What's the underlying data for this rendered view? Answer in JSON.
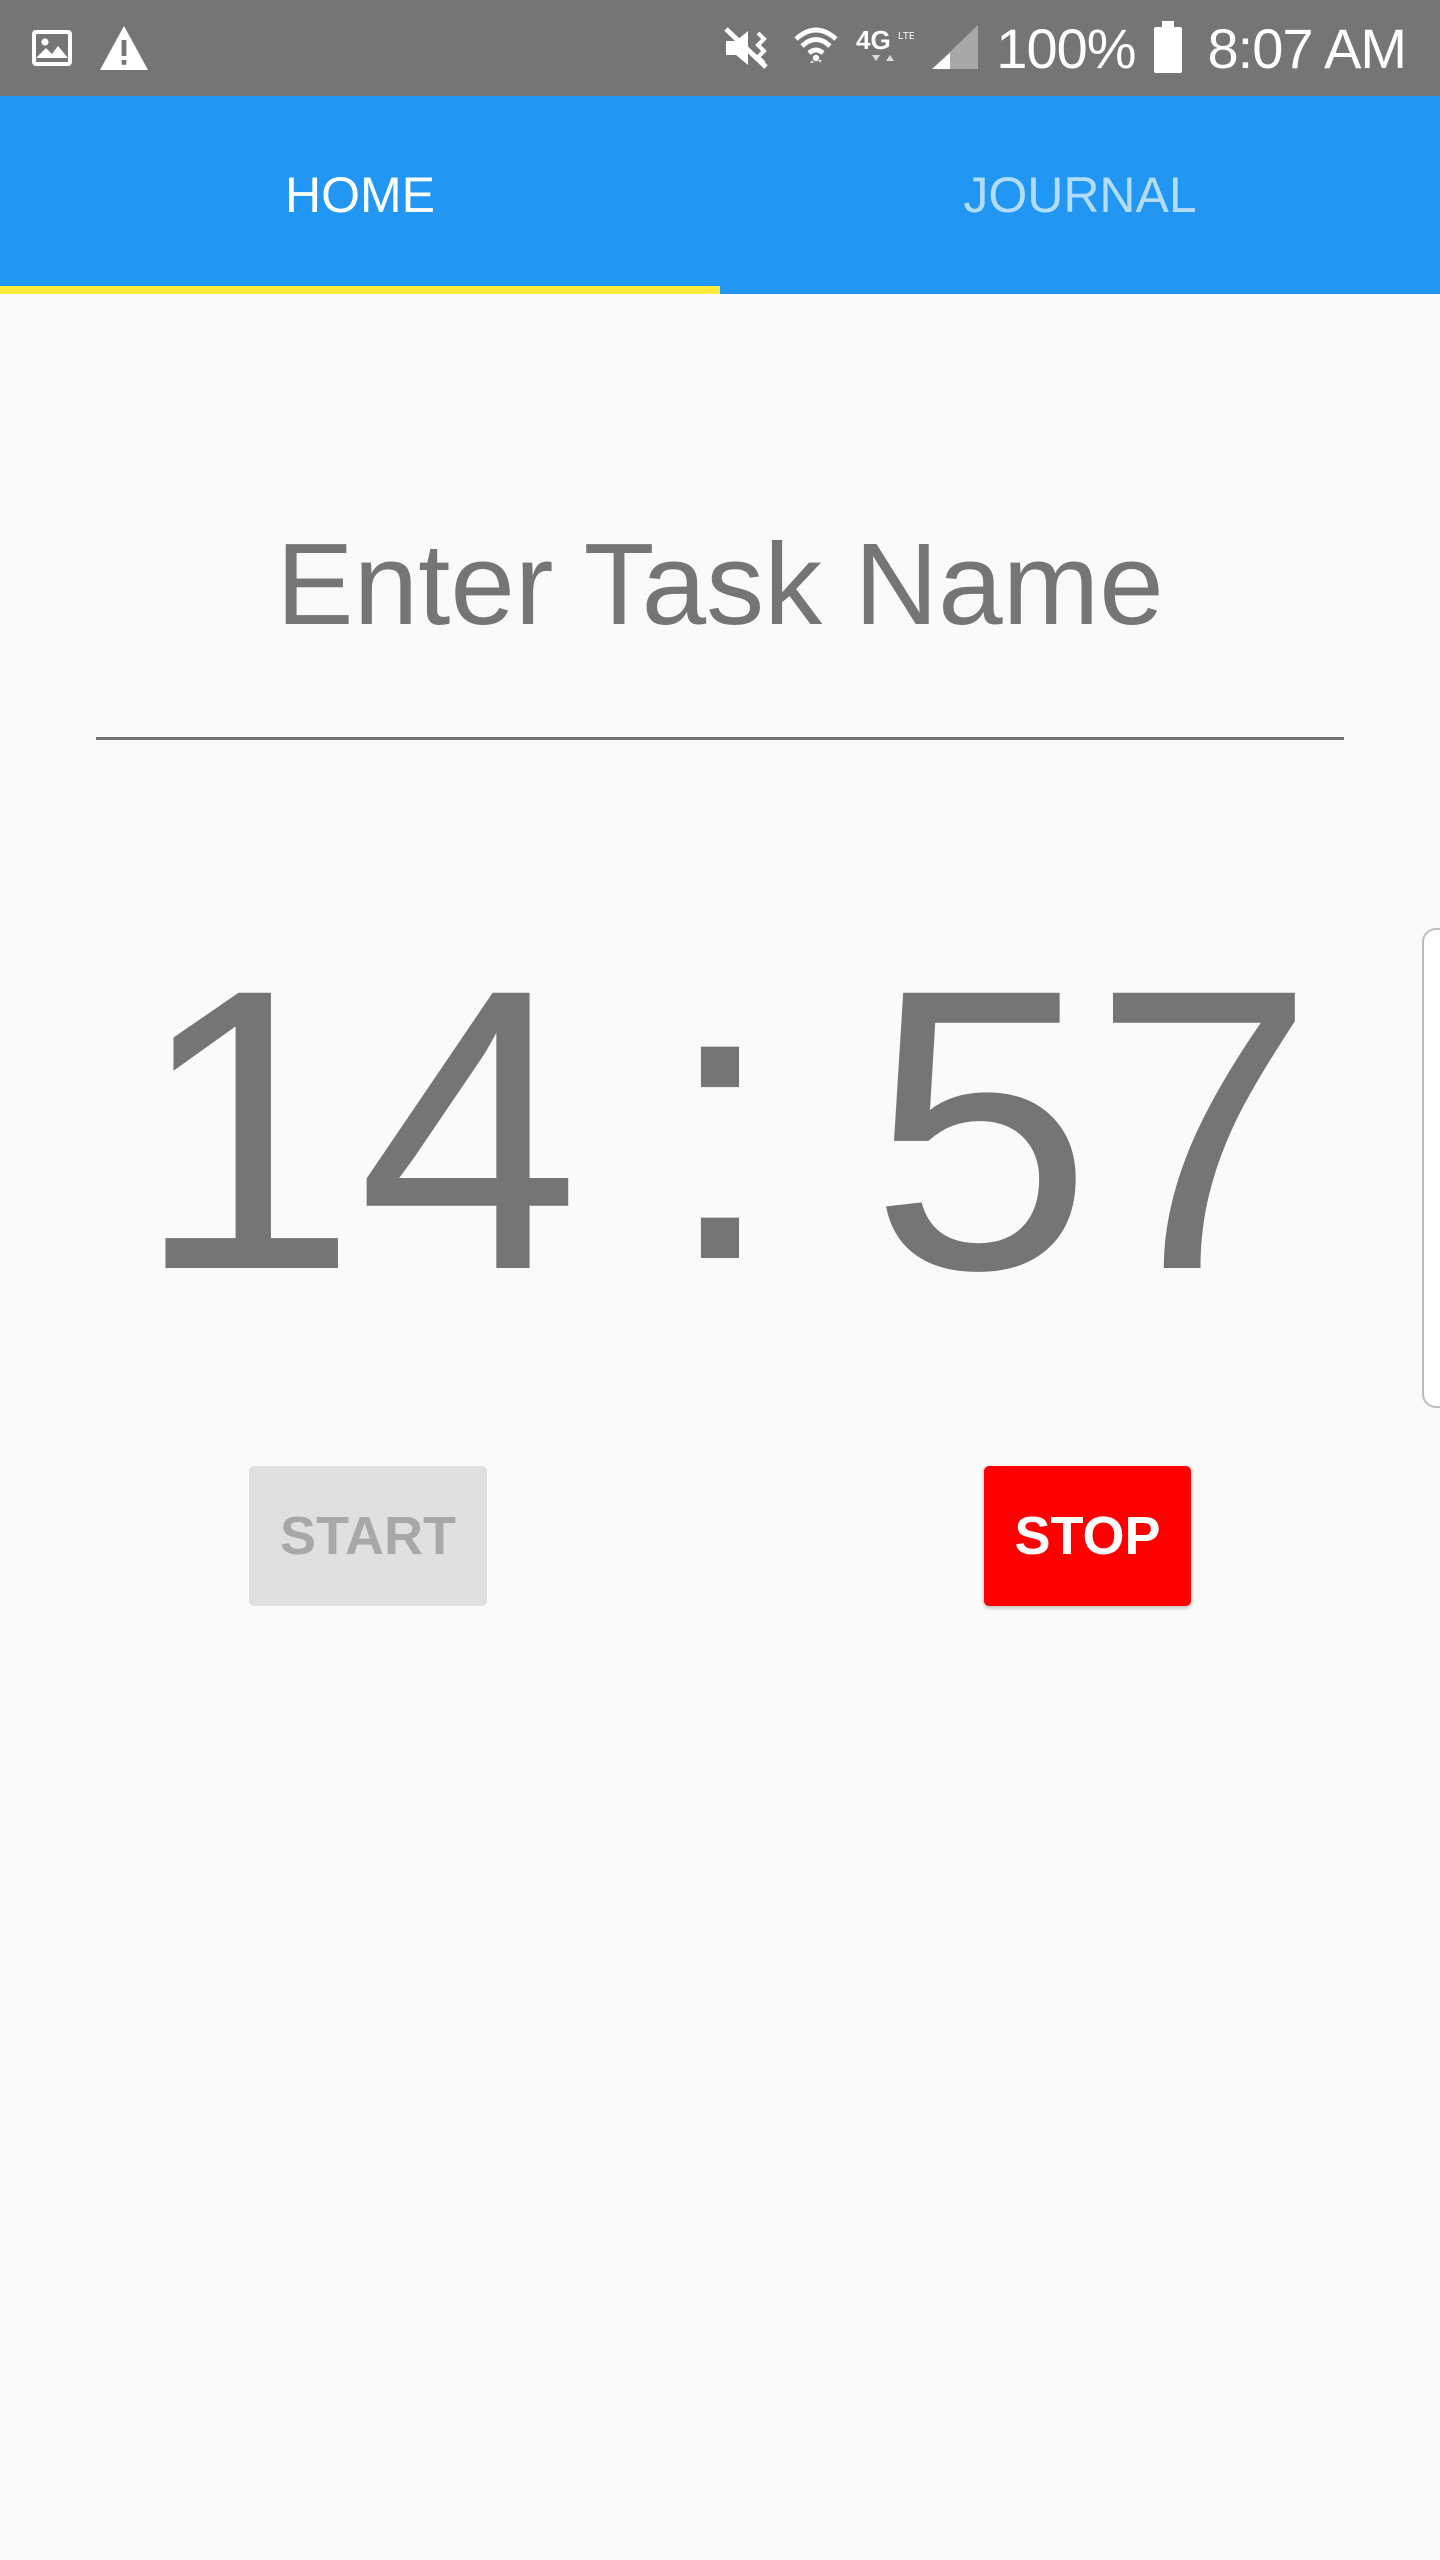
{
  "status_bar": {
    "battery_text": "100%",
    "time": "8:07 AM",
    "icons": [
      "image-icon",
      "warning-icon",
      "vibrate-mute-icon",
      "wifi-icon",
      "4g-lte-icon",
      "signal-icon",
      "battery-icon"
    ]
  },
  "tabs": [
    {
      "label": "HOME",
      "active": true
    },
    {
      "label": "JOURNAL",
      "active": false
    }
  ],
  "task": {
    "placeholder": "Enter Task Name",
    "value": ""
  },
  "timer": {
    "minutes": "14",
    "separator": ":",
    "seconds": "57"
  },
  "buttons": {
    "start_label": "START",
    "start_enabled": false,
    "stop_label": "STOP",
    "stop_enabled": true
  },
  "colors": {
    "status_bar": "#757575",
    "tab_bar": "#2196f3",
    "tab_indicator": "#ffeb3b",
    "text_gray": "#757575",
    "stop_button": "#ff0000",
    "start_button_disabled": "#e0e0e0",
    "background": "#fafafa"
  }
}
